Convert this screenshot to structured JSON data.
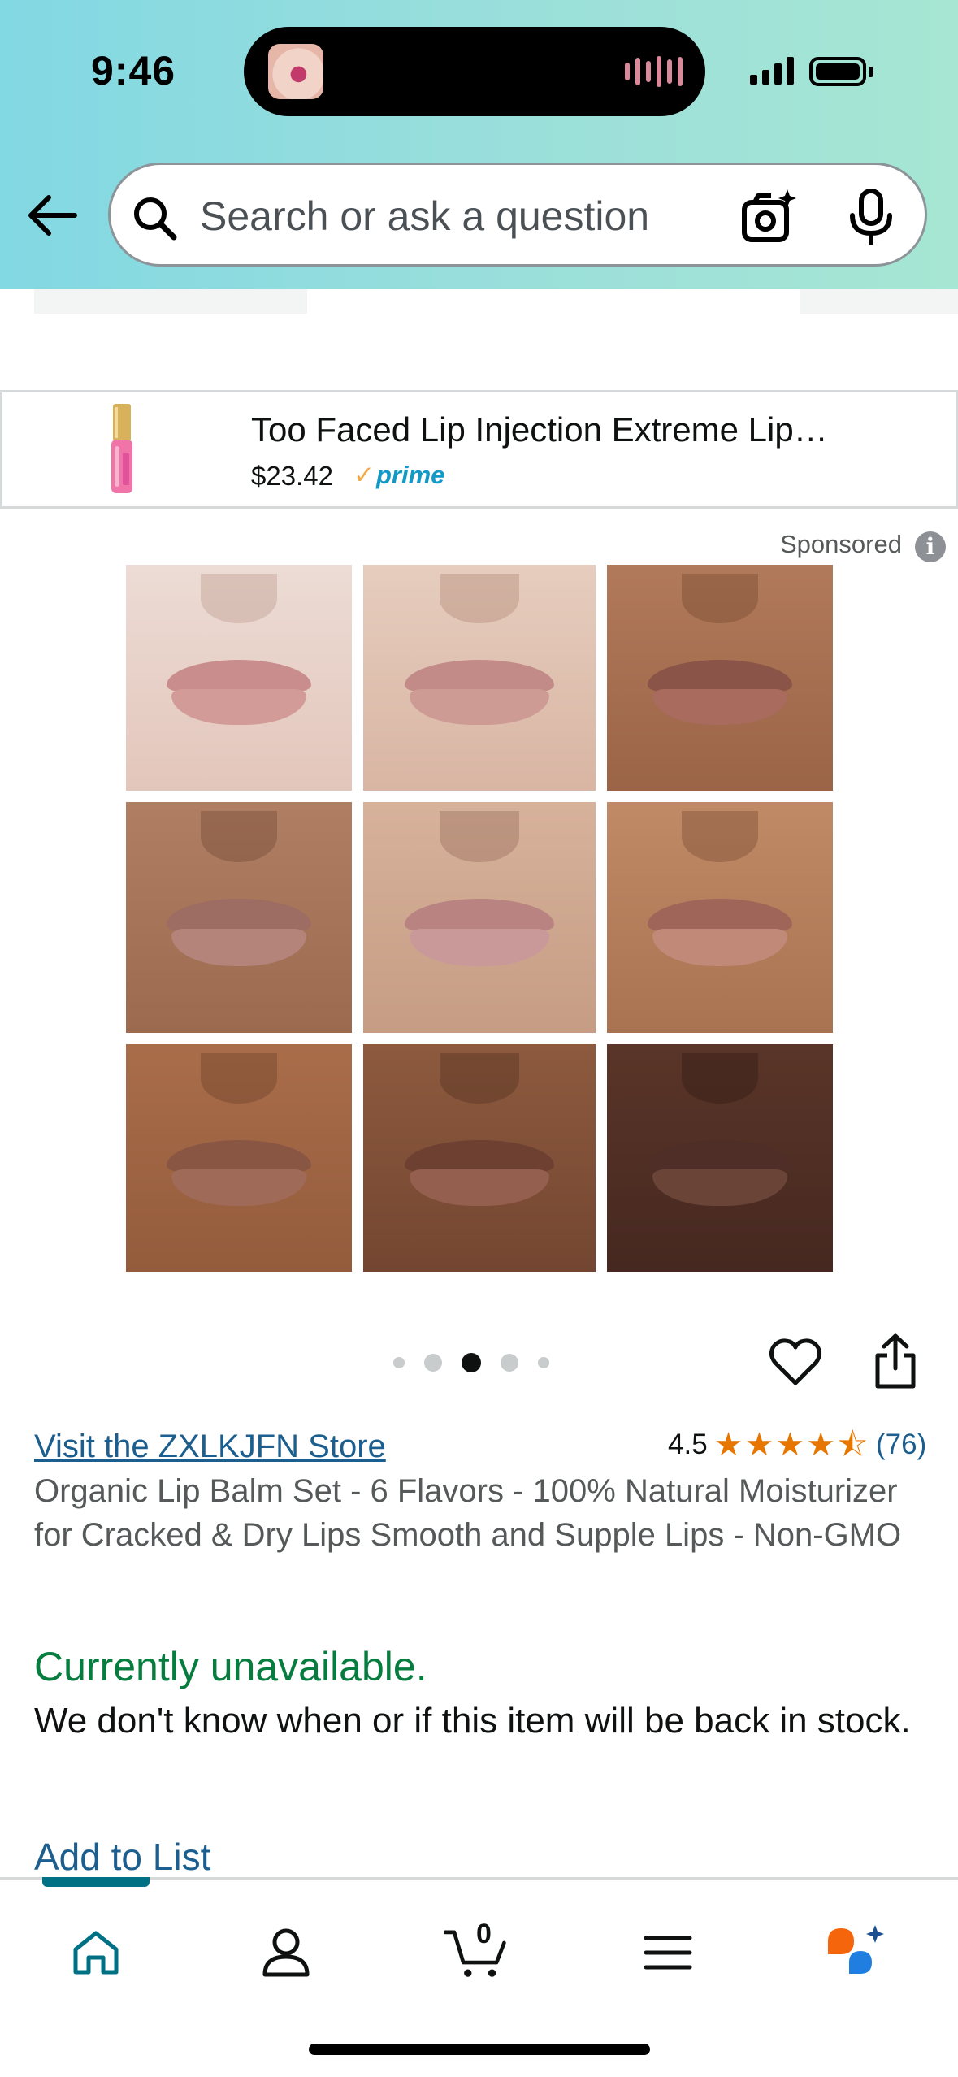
{
  "status_bar": {
    "time": "9:46"
  },
  "search": {
    "placeholder": "Search or ask a question"
  },
  "sponsored_banner": {
    "title": "Too Faced Lip Injection Extreme Lip…",
    "price": "$23.42",
    "prime_label": "prime",
    "prime_check": "✓"
  },
  "sponsored_label": "Sponsored",
  "image_carousel": {
    "dot_count": 5,
    "active_index": 2
  },
  "product": {
    "store_link": "Visit the ZXLKJFN Store",
    "rating": "4.5",
    "rating_count": "(76)",
    "stars": [
      "★",
      "★",
      "★",
      "★",
      "⯪"
    ],
    "title": "Organic Lip Balm Set - 6 Flavors - 100% Natural Moisturizer for Cracked & Dry Lips Smooth and Supple Lips - Non-GMO",
    "availability": "Currently unavailable.",
    "availability_desc": "We don't know when or if this item will be back in stock.",
    "add_to_list": "Add to List"
  },
  "bottom_nav": {
    "cart_count": "0",
    "active_item": "home"
  },
  "colors": {
    "link": "#1c5f8f",
    "available_green": "#067d3e",
    "star": "#e77600",
    "prime": "#1399c6",
    "nav_active": "#007185"
  }
}
